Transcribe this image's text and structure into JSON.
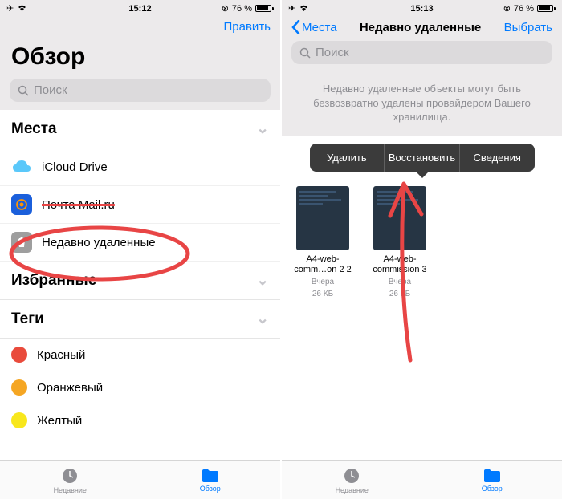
{
  "left": {
    "status": {
      "time": "15:12",
      "battery": "76 %"
    },
    "nav": {
      "edit": "Править"
    },
    "title": "Обзор",
    "search_placeholder": "Поиск",
    "sections": {
      "places": {
        "title": "Места",
        "items": [
          {
            "label": "iCloud Drive"
          },
          {
            "label": "Почта Mail.ru"
          },
          {
            "label": "Недавно удаленные"
          }
        ]
      },
      "favorites": {
        "title": "Избранные"
      },
      "tags": {
        "title": "Теги",
        "items": [
          {
            "label": "Красный",
            "color": "#e94b3c"
          },
          {
            "label": "Оранжевый",
            "color": "#f5a623"
          },
          {
            "label": "Желтый",
            "color": "#f8e71c"
          }
        ]
      }
    },
    "tabbar": {
      "recent": "Недавние",
      "browse": "Обзор"
    }
  },
  "right": {
    "status": {
      "time": "15:13",
      "battery": "76 %"
    },
    "nav": {
      "back": "Места",
      "title": "Недавно удаленные",
      "select": "Выбрать"
    },
    "search_placeholder": "Поиск",
    "notice": "Недавно удаленные объекты могут быть безвозвратно удалены провайдером Вашего хранилища.",
    "popover": {
      "delete": "Удалить",
      "restore": "Восстановить",
      "details": "Сведения"
    },
    "files": [
      {
        "name": "A4-web-comm…on 2 2",
        "date": "Вчера",
        "size": "26 КБ"
      },
      {
        "name": "A4-web-commission 3",
        "date": "Вчера",
        "size": "26 КБ"
      }
    ],
    "tabbar": {
      "recent": "Недавние",
      "browse": "Обзор"
    }
  }
}
